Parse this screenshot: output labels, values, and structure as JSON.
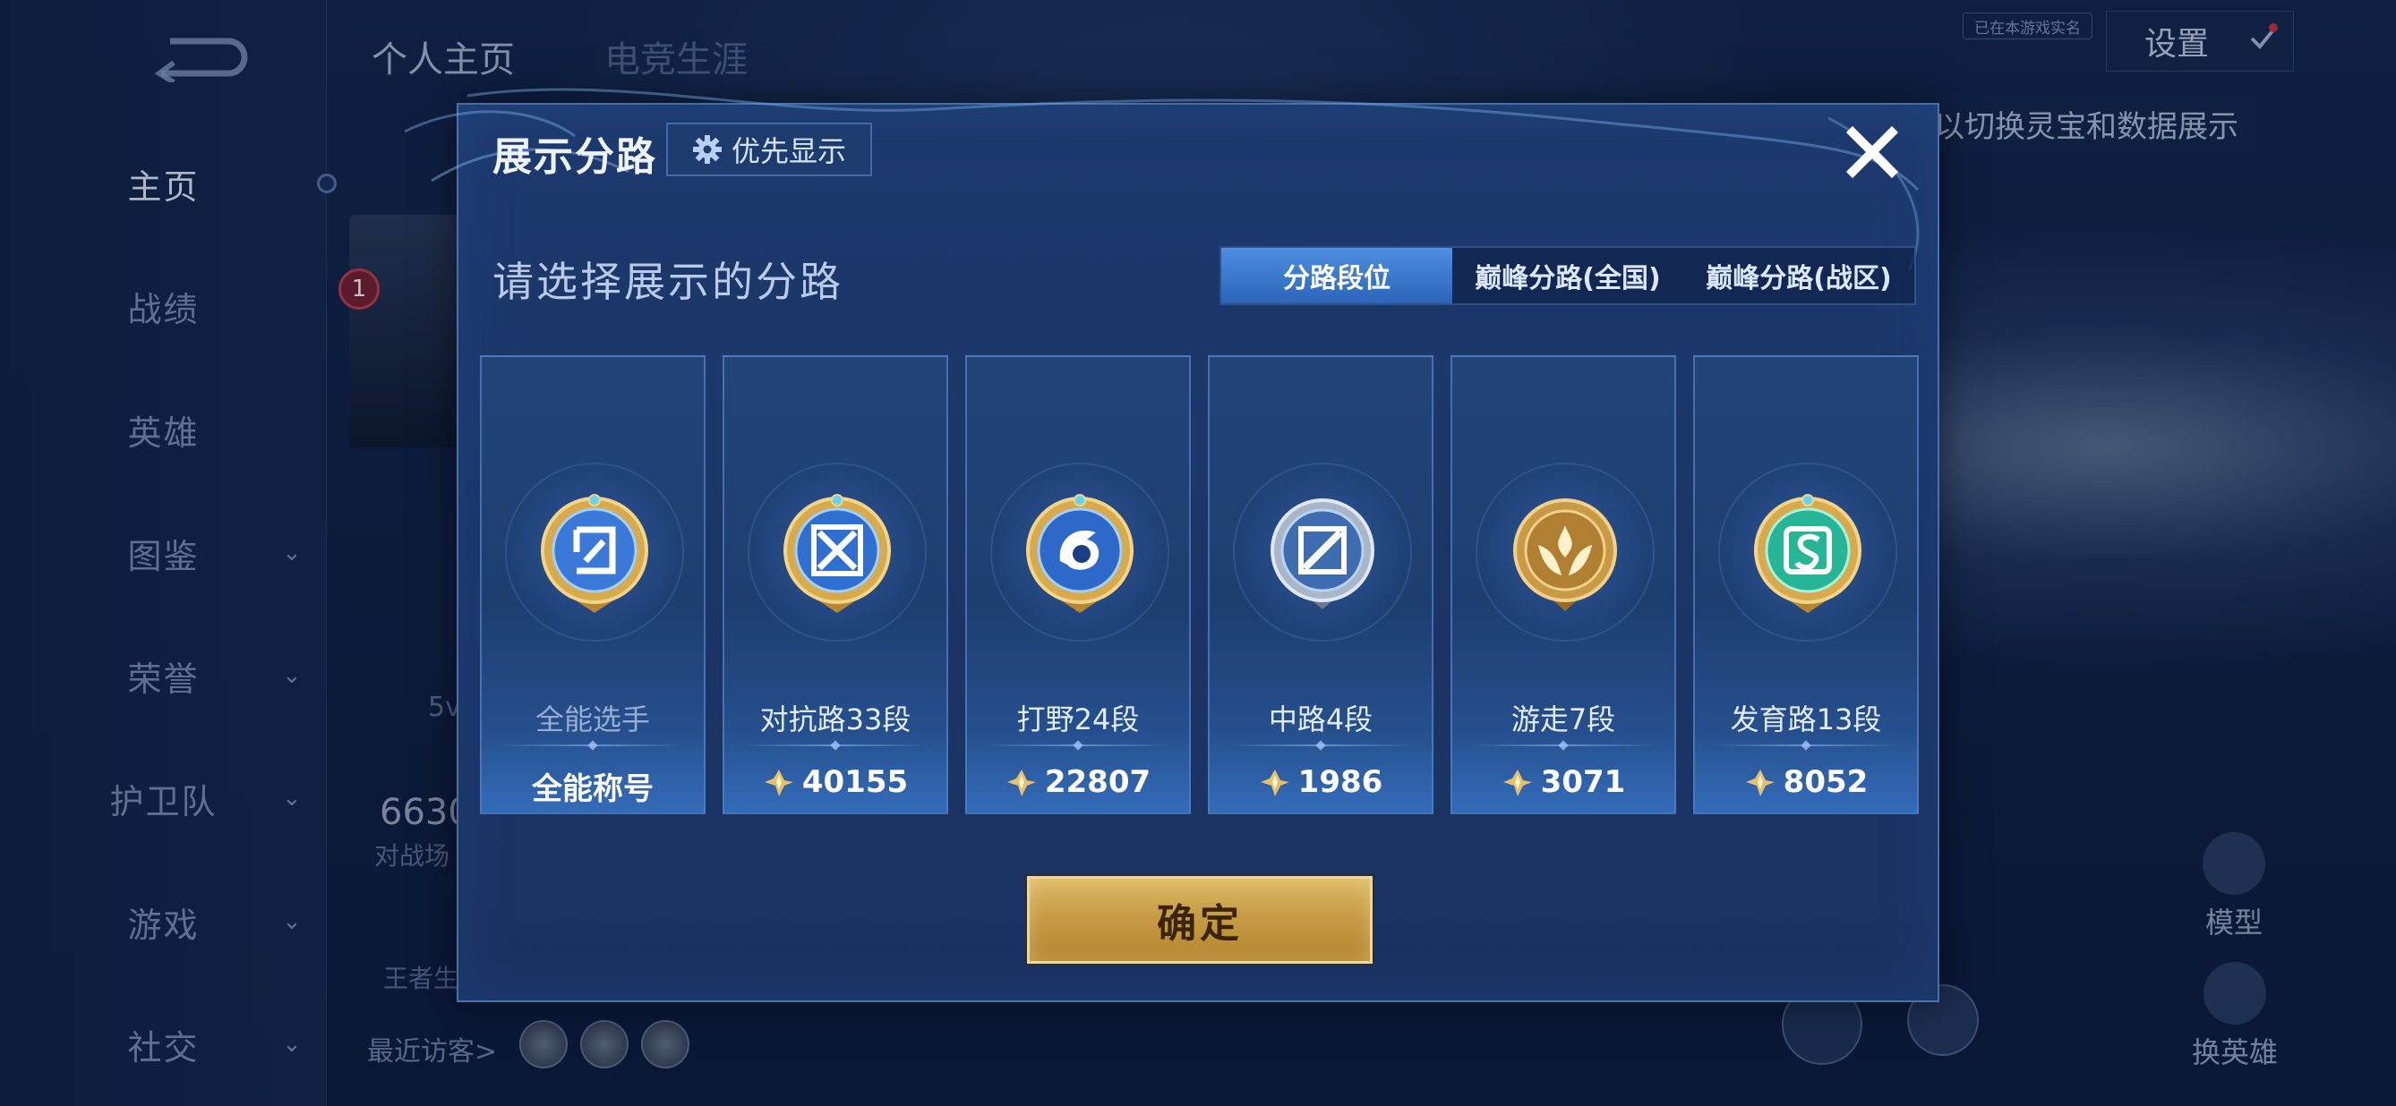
{
  "sidebar": {
    "items": [
      {
        "label": "主页",
        "active": true,
        "chevron": false
      },
      {
        "label": "战绩",
        "active": false,
        "chevron": false
      },
      {
        "label": "英雄",
        "active": false,
        "chevron": false
      },
      {
        "label": "图鉴",
        "active": false,
        "chevron": true
      },
      {
        "label": "荣誉",
        "active": false,
        "chevron": true
      },
      {
        "label": "护卫队",
        "active": false,
        "chevron": true
      },
      {
        "label": "游戏",
        "active": false,
        "chevron": true
      },
      {
        "label": "社交",
        "active": false,
        "chevron": true
      }
    ],
    "chevron_glyph": "⌄"
  },
  "header": {
    "tabs": [
      "个人主页",
      "电竞生涯"
    ],
    "settings_label": "设置",
    "hint": "以切换灵宝和数据展示",
    "corner_badge": "已在本游戏实名"
  },
  "background": {
    "card_badge": "1",
    "stat_value": "6630",
    "stat_label": "对战场",
    "mode_label": "5v",
    "life_label": "王者生",
    "recent_visitors": "最近访客>"
  },
  "right_controls": {
    "model_label": "模型",
    "swap_label": "换英雄"
  },
  "modal": {
    "title": "展示分路",
    "priority_label": "优先显示",
    "subtitle": "请选择展示的分路",
    "tabs": [
      {
        "label": "分路段位",
        "active": true
      },
      {
        "label": "巅峰分路(全国)",
        "active": false
      },
      {
        "label": "巅峰分路(战区)",
        "active": false
      }
    ],
    "cards": [
      {
        "name": "全能选手",
        "value": "全能称号",
        "has_points_icon": false,
        "emblem": "all-round-emblem"
      },
      {
        "name": "对抗路33段",
        "value": "40155",
        "has_points_icon": true,
        "emblem": "clash-lane-emblem"
      },
      {
        "name": "打野24段",
        "value": "22807",
        "has_points_icon": true,
        "emblem": "jungle-emblem"
      },
      {
        "name": "中路4段",
        "value": "1986",
        "has_points_icon": true,
        "emblem": "mid-lane-emblem"
      },
      {
        "name": "游走7段",
        "value": "3071",
        "has_points_icon": true,
        "emblem": "roam-emblem"
      },
      {
        "name": "发育路13段",
        "value": "8052",
        "has_points_icon": true,
        "emblem": "farm-lane-emblem"
      }
    ],
    "confirm_label": "确定"
  },
  "colors": {
    "accent_blue": "#3a78cf",
    "gold": "#c89c46",
    "panel": "#1d3a6e"
  }
}
